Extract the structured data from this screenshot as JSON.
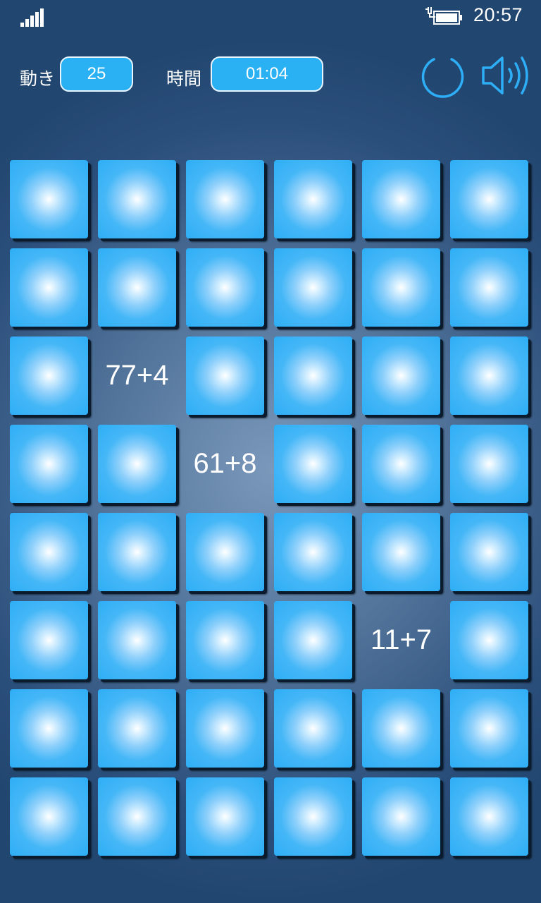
{
  "status_bar": {
    "time": "20:57",
    "signal_icon": "signal-icon",
    "battery_icon": "battery-charging-icon"
  },
  "header": {
    "moves_label": "動き",
    "moves_value": "25",
    "time_label": "時間",
    "time_value": "01:04",
    "restart_icon": "restart-icon",
    "sound_icon": "speaker-icon"
  },
  "colors": {
    "tile": "#2eaef6",
    "pill": "#29b1f4",
    "background": "#3a5f8a"
  },
  "board": {
    "columns": 6,
    "rows": 8,
    "revealed": [
      {
        "row": 2,
        "col": 1,
        "text": "77+4"
      },
      {
        "row": 3,
        "col": 2,
        "text": "61+8"
      },
      {
        "row": 5,
        "col": 4,
        "text": "11+7"
      }
    ]
  }
}
